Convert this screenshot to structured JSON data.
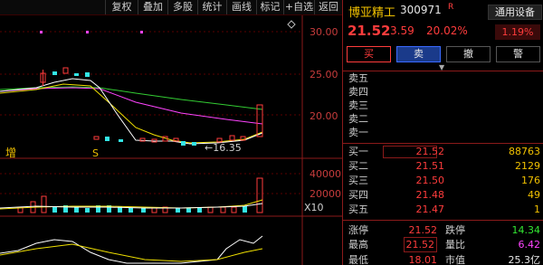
{
  "toolbar": {
    "items": [
      "复权",
      "叠加",
      "多股",
      "统计",
      "画线",
      "标记",
      "+自选",
      "返回"
    ]
  },
  "chart": {
    "price_ticks": [
      "30.00",
      "25.00",
      "20.00"
    ],
    "volume_ticks": [
      "40000",
      "20000"
    ],
    "volume_unit": "X10",
    "low_marker": "16.35",
    "label_zeng": "增",
    "label_s": "S"
  },
  "stock": {
    "name": "博亚精工",
    "code": "300971",
    "flag": "R",
    "sector": "通用设备",
    "sector_pct": "1.19%",
    "price": "21.52",
    "change": "3.59",
    "pct": "20.02%"
  },
  "trade_buttons": [
    "买",
    "卖",
    "撤",
    "警"
  ],
  "orderbook": {
    "asks": [
      {
        "label": "卖五",
        "price": "",
        "vol": ""
      },
      {
        "label": "卖四",
        "price": "",
        "vol": ""
      },
      {
        "label": "卖三",
        "price": "",
        "vol": ""
      },
      {
        "label": "卖二",
        "price": "",
        "vol": ""
      },
      {
        "label": "卖一",
        "price": "",
        "vol": ""
      }
    ],
    "bids": [
      {
        "label": "买一",
        "price": "21.52",
        "vol": "88763"
      },
      {
        "label": "买二",
        "price": "21.51",
        "vol": "2129"
      },
      {
        "label": "买三",
        "price": "21.50",
        "vol": "176"
      },
      {
        "label": "买四",
        "price": "21.48",
        "vol": "49"
      },
      {
        "label": "买五",
        "price": "21.47",
        "vol": "1"
      }
    ]
  },
  "stats": [
    {
      "l1": "涨停",
      "v1": "21.52",
      "l2": "跌停",
      "v2": "14.34"
    },
    {
      "l1": "最高",
      "v1": "21.52",
      "l2": "量比",
      "v2": "6.42"
    },
    {
      "l1": "最低",
      "v1": "18.01",
      "l2": "市值",
      "v2": "25.3亿"
    }
  ],
  "colors": {
    "up": "#ff3c3c",
    "down": "#33e633",
    "ma5": "#ffffff",
    "ma10": "#f0e000",
    "ma20": "#ff44ff",
    "ma60": "#33cc33"
  }
}
